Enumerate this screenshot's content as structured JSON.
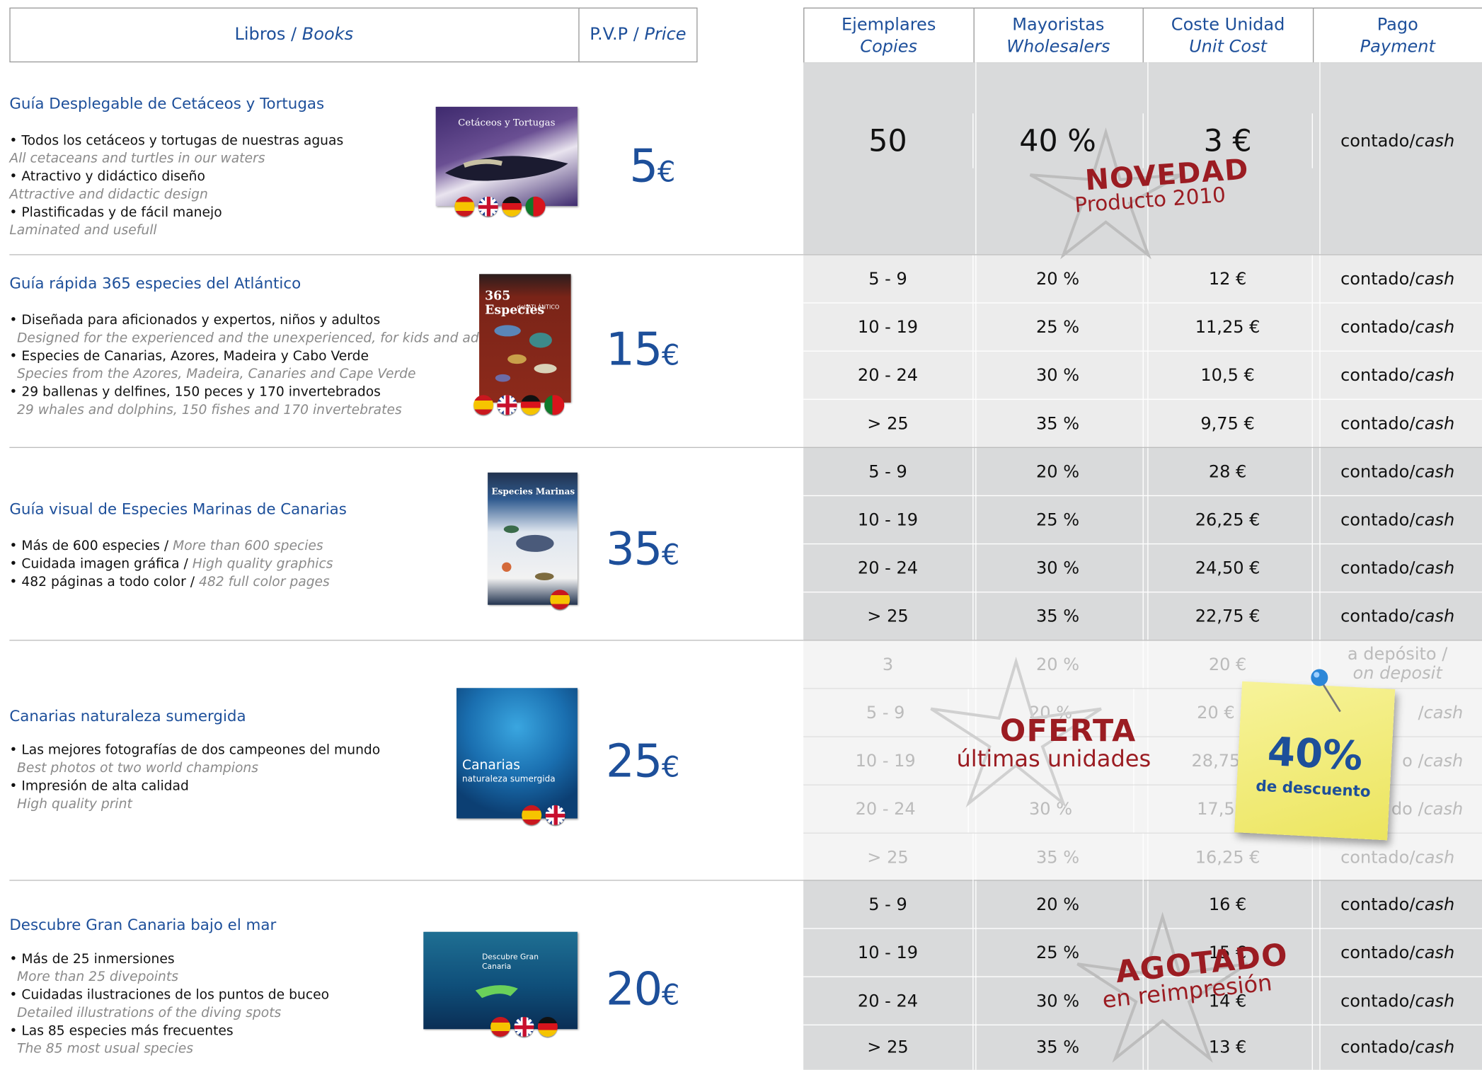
{
  "header": {
    "books_es": "Libros",
    "books_sep": " / ",
    "books_en": "Books",
    "pvp_es": "P.V.P",
    "pvp_sep": " / ",
    "pvp_en": "Price",
    "columns": [
      {
        "es": "Ejemplares",
        "en": "Copies"
      },
      {
        "es": "Mayoristas",
        "en": "Wholesalers"
      },
      {
        "es": "Coste Unidad",
        "en": "Unit Cost"
      },
      {
        "es": "Pago",
        "en": "Payment"
      }
    ]
  },
  "products": [
    {
      "title": "Guía Desplegable de Cetáceos y Tortugas",
      "bullets": [
        {
          "es": "• Todos los cetáceos y tortugas de nuestras aguas",
          "en": "All cetaceans and turtles in our waters"
        },
        {
          "es": "• Atractivo y didáctico diseño",
          "en": "Attractive and didactic design"
        },
        {
          "es": "• Plastificadas y de fácil manejo",
          "en": "Laminated and usefull"
        }
      ],
      "price": "5",
      "currency": "€",
      "cover_title": "Cetáceos y Tortugas",
      "flags": [
        "es",
        "uk",
        "de",
        "pt"
      ],
      "rows": [
        {
          "copies": "50",
          "discount": "40 %",
          "unit": "3 €",
          "pay_es": "contado",
          "pay_sep": " / ",
          "pay_en": "cash"
        }
      ],
      "stamp": {
        "main": "NOVEDAD",
        "sub": "Producto 2010"
      }
    },
    {
      "title": "Guía rápida 365 especies del Atlántico",
      "bullets": [
        {
          "es": "• Diseñada para aficionados y expertos, niños y adultos",
          "en": "Designed for the experienced and the unexperienced, for kids and adults"
        },
        {
          "es": "• Especies de Canarias, Azores, Madeira y Cabo Verde",
          "en": "Species from the Azores, Madeira, Canaries and Cape Verde"
        },
        {
          "es": "• 29 ballenas y delfines, 150 peces y 170 invertebrados",
          "en": "29 whales and dolphins, 150 fishes and 170 invertebrates"
        }
      ],
      "price": "15",
      "currency": "€",
      "cover_title": "365 Especies",
      "cover_sub": "del ATLÁNTICO",
      "flags": [
        "es",
        "uk",
        "de",
        "pt"
      ],
      "rows": [
        {
          "copies": "5 - 9",
          "discount": "20 %",
          "unit": "12 €",
          "pay_es": "contado",
          "pay_sep": " / ",
          "pay_en": "cash"
        },
        {
          "copies": "10 - 19",
          "discount": "25 %",
          "unit": "11,25 €",
          "pay_es": "contado",
          "pay_sep": " / ",
          "pay_en": "cash"
        },
        {
          "copies": "20 - 24",
          "discount": "30 %",
          "unit": "10,5 €",
          "pay_es": "contado",
          "pay_sep": " / ",
          "pay_en": "cash"
        },
        {
          "copies": "> 25",
          "discount": "35 %",
          "unit": "9,75 €",
          "pay_es": "contado",
          "pay_sep": " / ",
          "pay_en": "cash"
        }
      ]
    },
    {
      "title": "Guía visual de Especies Marinas de Canarias",
      "bullets": [
        {
          "es": "• Más de 600 especies / ",
          "en": "More than 600 species"
        },
        {
          "es": "• Cuidada imagen gráfica / ",
          "en": "High quality graphics"
        },
        {
          "es": "• 482 páginas a todo color / ",
          "en": "482 full color pages"
        }
      ],
      "price": "35",
      "currency": "€",
      "cover_title": "Especies Marinas",
      "flags": [
        "es"
      ],
      "rows": [
        {
          "copies": "5 - 9",
          "discount": "20 %",
          "unit": "28 €",
          "pay_es": "contado",
          "pay_sep": " / ",
          "pay_en": "cash"
        },
        {
          "copies": "10 - 19",
          "discount": "25 %",
          "unit": "26,25 €",
          "pay_es": "contado",
          "pay_sep": " / ",
          "pay_en": "cash"
        },
        {
          "copies": "20 - 24",
          "discount": "30 %",
          "unit": "24,50 €",
          "pay_es": "contado",
          "pay_sep": " / ",
          "pay_en": "cash"
        },
        {
          "copies": "> 25",
          "discount": "35 %",
          "unit": "22,75 €",
          "pay_es": "contado",
          "pay_sep": " / ",
          "pay_en": "cash"
        }
      ]
    },
    {
      "title": "Canarias naturaleza sumergida",
      "bullets": [
        {
          "es": "• Las mejores fotografías de dos campeones del mundo",
          "en": "Best photos ot two world champions"
        },
        {
          "es": "• Impresión de alta calidad",
          "en": "High quality print"
        }
      ],
      "price": "25",
      "currency": "€",
      "cover_title": "Canarias",
      "cover_sub": "naturaleza sumergida",
      "flags": [
        "es",
        "uk"
      ],
      "rows": [
        {
          "copies": "3",
          "discount": "20 %",
          "unit": "20 €",
          "pay_es": "a depósito /",
          "pay_sep": "",
          "pay_en": "on deposit"
        },
        {
          "copies": "5 - 9",
          "discount": "20 %",
          "unit": "20 €",
          "pay_es": "",
          "pay_sep": "/ ",
          "pay_en": "cash"
        },
        {
          "copies": "10 - 19",
          "discount": "",
          "unit": "28,75",
          "pay_es": "",
          "pay_sep": "o / ",
          "pay_en": "cash"
        },
        {
          "copies": "20 - 24",
          "discount": "30 %",
          "unit": "17,5",
          "pay_es": "",
          "pay_sep": "do / ",
          "pay_en": "cash"
        },
        {
          "copies": "> 25",
          "discount": "35 %",
          "unit": "16,25 €",
          "pay_es": "contado",
          "pay_sep": " / ",
          "pay_en": "cash"
        }
      ],
      "stamp": {
        "main": "OFERTA",
        "sub": "últimas unidades"
      },
      "note": {
        "big": "40%",
        "small": "de descuento"
      }
    },
    {
      "title": "Descubre Gran Canaria bajo el mar",
      "bullets": [
        {
          "es": "• Más de 25 inmersiones",
          "en": "More than 25 divepoints"
        },
        {
          "es": "• Cuidadas ilustraciones de los puntos de buceo",
          "en": "Detailed illustrations of the diving spots"
        },
        {
          "es": "• Las 85 especies más frecuentes",
          "en": "The 85 most usual species"
        }
      ],
      "price": "20",
      "currency": "€",
      "cover_title": "Descubre Gran Canaria",
      "flags": [
        "es",
        "uk",
        "de"
      ],
      "rows": [
        {
          "copies": "5 - 9",
          "discount": "20 %",
          "unit": "16 €",
          "pay_es": "contado",
          "pay_sep": " / ",
          "pay_en": "cash"
        },
        {
          "copies": "10 - 19",
          "discount": "25 %",
          "unit": "15 €",
          "pay_es": "contado",
          "pay_sep": " / ",
          "pay_en": "cash"
        },
        {
          "copies": "20 - 24",
          "discount": "30 %",
          "unit": "14 €",
          "pay_es": "contado",
          "pay_sep": " / ",
          "pay_en": "cash"
        },
        {
          "copies": "> 25",
          "discount": "35 %",
          "unit": "13 €",
          "pay_es": "contado",
          "pay_sep": " / ",
          "pay_en": "cash"
        }
      ],
      "stamp": {
        "main": "AGOTADO",
        "sub": "en reimpresión"
      }
    }
  ],
  "colors": {
    "accent": "#1d4f9a",
    "stamp": "#9b1c22",
    "note": "#f3ee7c",
    "row_dark": "#d9dadb",
    "row_light": "#ececec"
  }
}
